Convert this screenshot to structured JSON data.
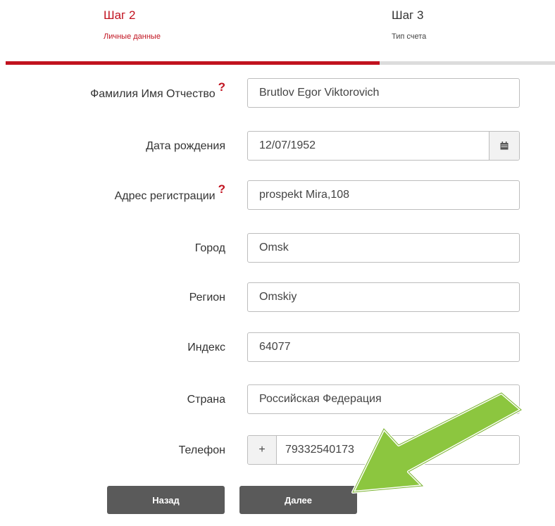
{
  "steps": [
    {
      "title": "Шаг 2",
      "subtitle": "Личные данные",
      "active": true
    },
    {
      "title": "Шаг 3",
      "subtitle": "Тип счета",
      "active": false
    }
  ],
  "form": {
    "fullname": {
      "label": "Фамилия Имя Отчество",
      "help": "?",
      "value": "Brutlov Egor Viktorovich"
    },
    "birthdate": {
      "label": "Дата рождения",
      "value": "12/07/1952"
    },
    "address": {
      "label": "Адрес регистрации",
      "help": "?",
      "value": "prospekt Mira,108"
    },
    "city": {
      "label": "Город",
      "value": "Omsk"
    },
    "region": {
      "label": "Регион",
      "value": "Omskiy"
    },
    "index": {
      "label": "Индекс",
      "value": "64077"
    },
    "country": {
      "label": "Страна",
      "value": "Российская Федерация"
    },
    "phone": {
      "label": "Телефон",
      "prefix": "+",
      "value": "79332540173"
    }
  },
  "buttons": {
    "back": "Назад",
    "next": "Далее"
  },
  "colors": {
    "accent": "#c1121f",
    "arrow": "#8cc63f",
    "button": "#5a5a5a"
  },
  "icons": {
    "calendar": "calendar-icon",
    "arrow": "arrow-annotation"
  }
}
